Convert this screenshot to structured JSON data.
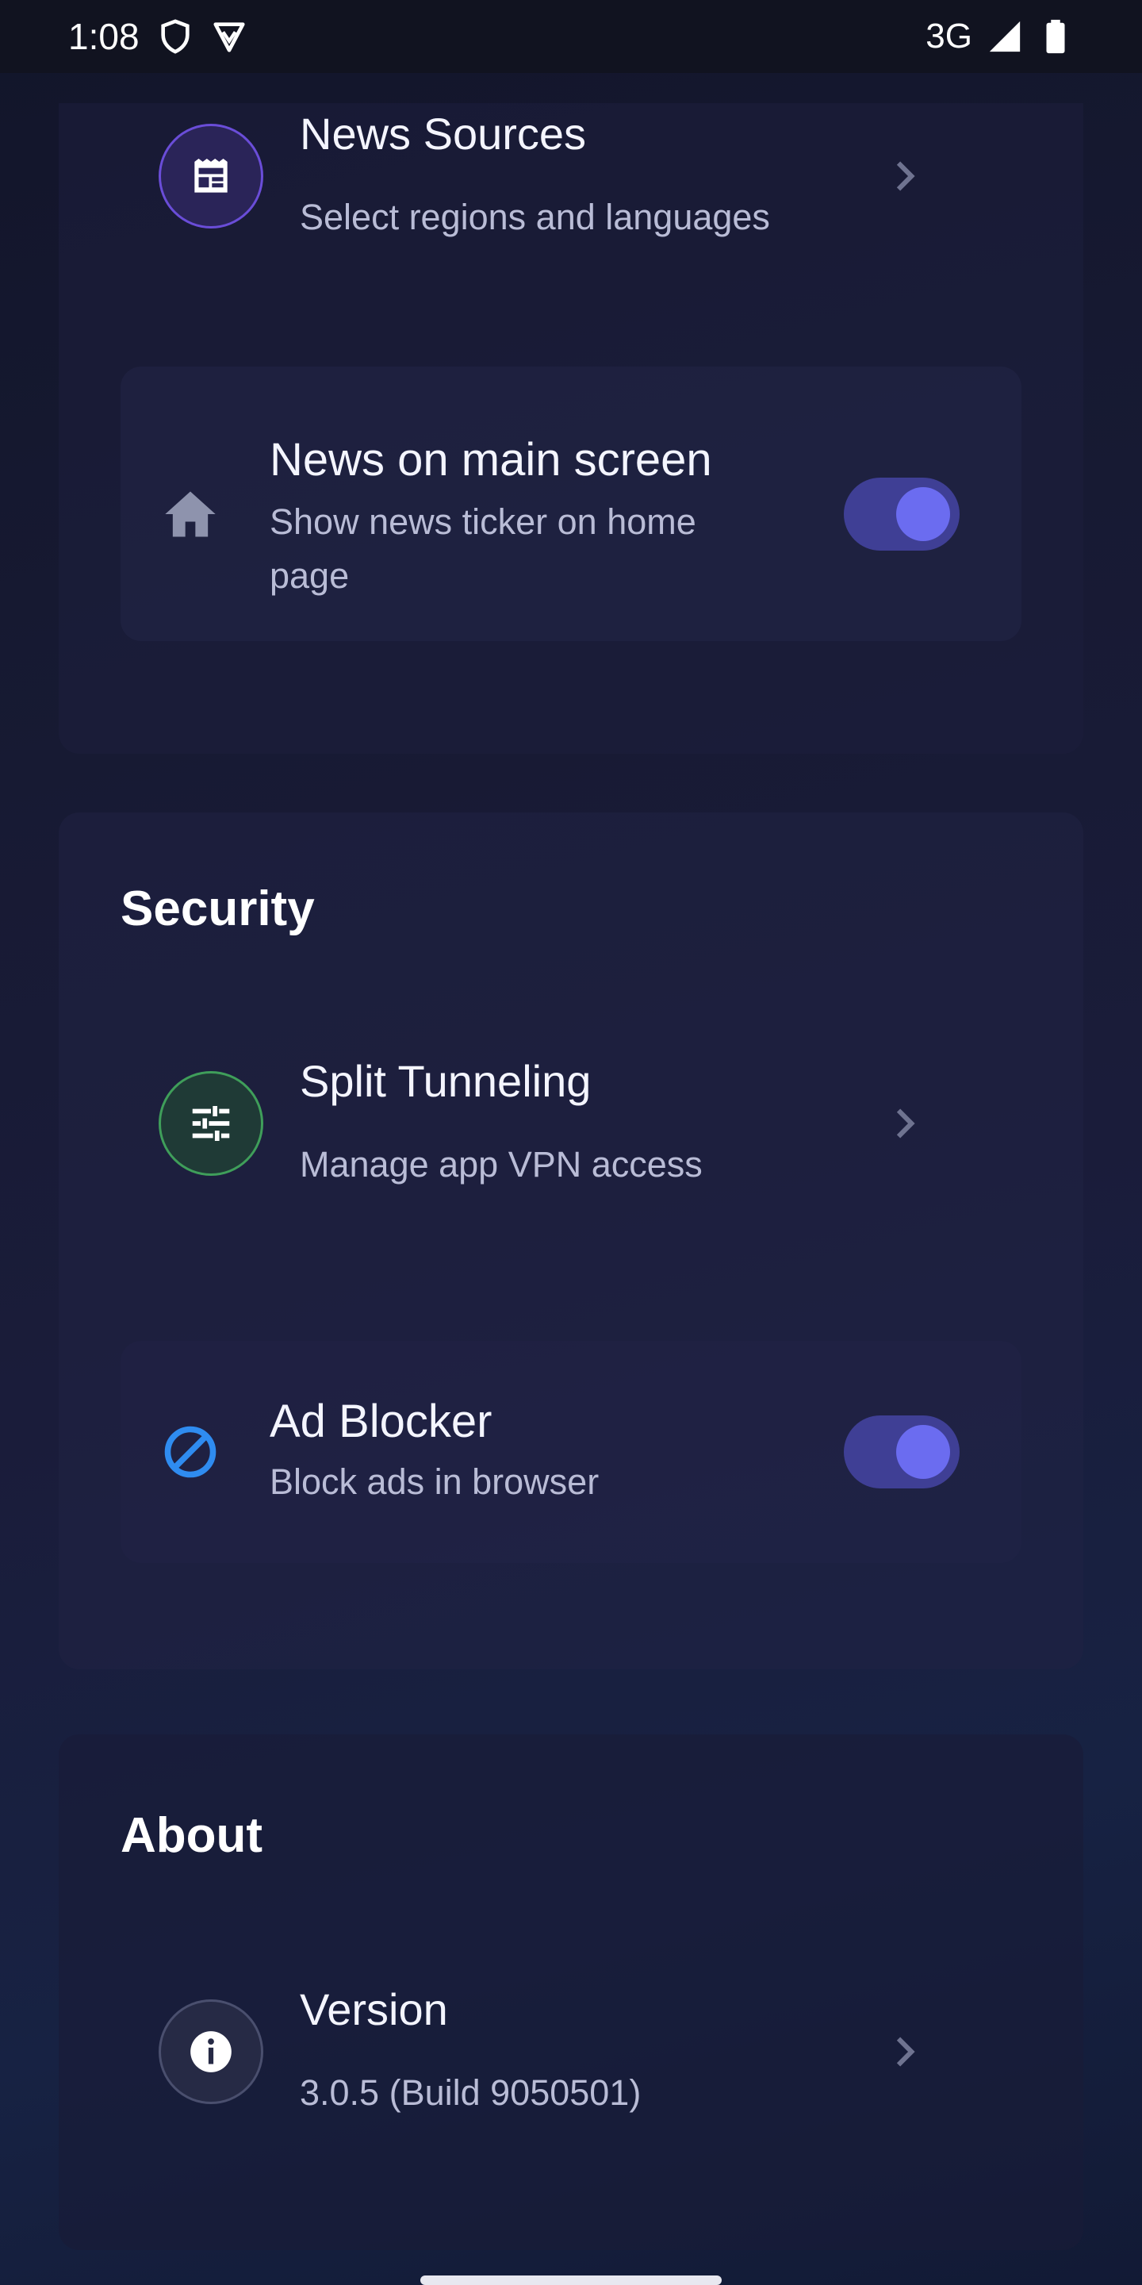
{
  "status_bar": {
    "time": "1:08",
    "network": "3G",
    "icons": [
      "shield-icon",
      "vpn-badge-icon",
      "signal-icon",
      "battery-icon"
    ]
  },
  "news": {
    "sources": {
      "title": "News Sources",
      "subtitle": "Select regions and languages",
      "icon": "newspaper-icon",
      "accent": "#7b5cff"
    },
    "main_screen": {
      "title": "News on main screen",
      "subtitle": "Show news ticker on home page",
      "icon": "home-icon",
      "enabled": true
    }
  },
  "security": {
    "title": "Security",
    "split_tunneling": {
      "title": "Split Tunneling",
      "subtitle": "Manage app VPN access",
      "icon": "tune-sliders-icon",
      "accent": "#3f9e5a"
    },
    "ad_blocker": {
      "title": "Ad Blocker",
      "subtitle": "Block ads in browser",
      "icon": "block-icon",
      "enabled": true,
      "accent": "#2f8cf0"
    }
  },
  "about": {
    "title": "About",
    "version": {
      "title": "Version",
      "subtitle": "3.0.5 (Build 9050501)",
      "icon": "info-icon"
    }
  },
  "colors": {
    "toggle_track": "#3f3f95",
    "toggle_knob": "#6b6cf0",
    "background": "#171a33"
  }
}
